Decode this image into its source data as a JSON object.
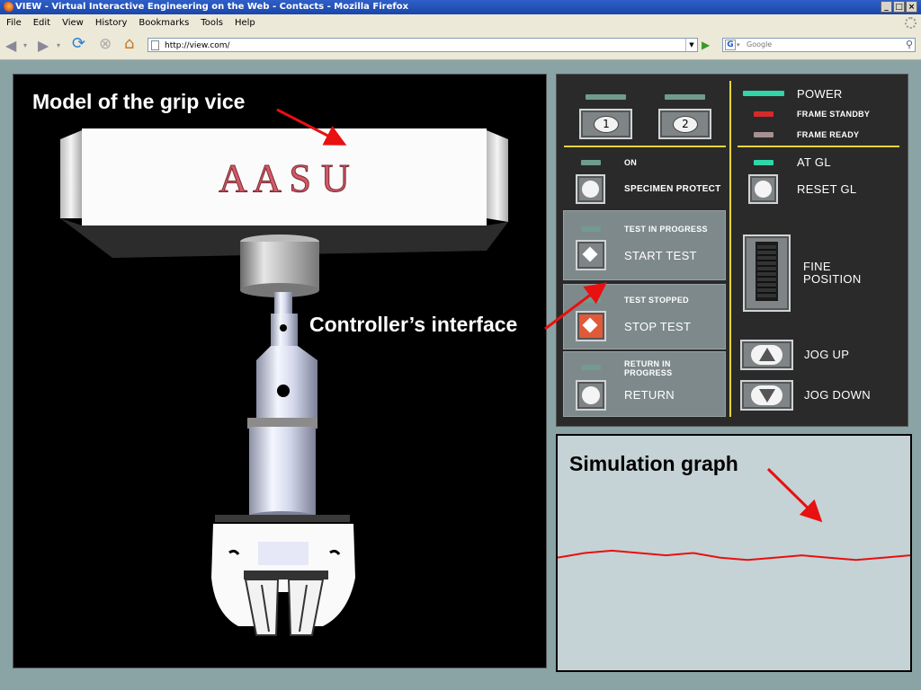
{
  "window": {
    "title": "VIEW - Virtual Interactive Engineering on the Web - Contacts - Mozilla Firefox",
    "controls": [
      "_",
      "□",
      "×"
    ]
  },
  "menu": [
    "File",
    "Edit",
    "View",
    "History",
    "Bookmarks",
    "Tools",
    "Help"
  ],
  "navbar": {
    "url": "http://view.com/",
    "search_placeholder": "Google",
    "search_engine_glyph": "G"
  },
  "annotations": {
    "model": "Model of the grip vice",
    "controller": "Controller’s interface",
    "graph": "Simulation graph"
  },
  "model": {
    "sign_text": "A A S U"
  },
  "controller": {
    "station_buttons": [
      "1",
      "2"
    ],
    "status": {
      "power": "POWER",
      "frame_standby": "FRAME STANDBY",
      "frame_ready": "FRAME READY"
    },
    "on": "ON",
    "specimen_protect": "SPECIMEN PROTECT",
    "at_gl": "AT GL",
    "reset_gl": "RESET GL",
    "test_in_progress": "TEST IN PROGRESS",
    "start_test": "START TEST",
    "test_stopped": "TEST STOPPED",
    "stop_test": "STOP TEST",
    "return_in_progress_1": "RETURN IN",
    "return_in_progress_2": "PROGRESS",
    "return": "RETURN",
    "fine_position_1": "FINE",
    "fine_position_2": "POSITION",
    "jog_up": "JOG UP",
    "jog_down": "JOG DOWN"
  },
  "colors": {
    "led_green": "#2fd6a6",
    "led_red": "#d42a2a",
    "led_dim": "#6f9c8e",
    "stop_red": "#e05a3a",
    "graph_line": "#e81010",
    "annotation_arrow": "#e81010"
  },
  "graph": {
    "y_values": [
      0.52,
      0.5,
      0.49,
      0.5,
      0.51,
      0.5,
      0.52,
      0.53,
      0.52,
      0.51,
      0.52,
      0.53,
      0.52,
      0.51
    ]
  }
}
